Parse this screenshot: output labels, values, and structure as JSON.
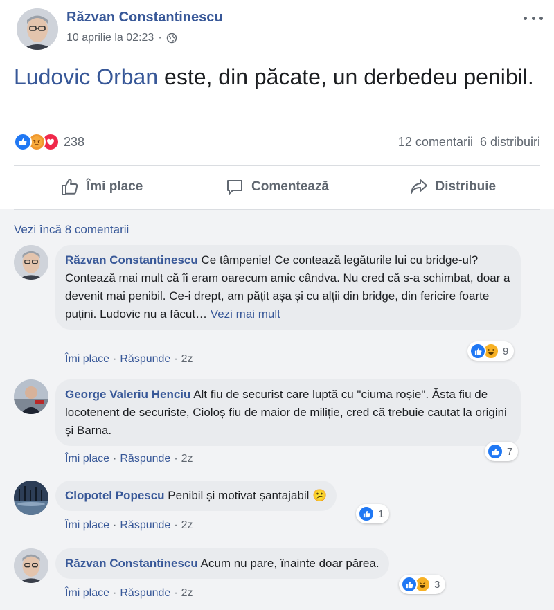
{
  "post": {
    "author": "Răzvan Constantinescu",
    "date": "10 aprilie la 02:23",
    "dot": "·",
    "privacy_icon": "globe-icon",
    "text_mention": "Ludovic Orban",
    "text_rest": " este, din păcate, un derbedeu penibil.",
    "reaction_icons": [
      "like-icon",
      "angry-icon",
      "love-icon"
    ],
    "reaction_count": "238",
    "comments_count": "12 comentarii",
    "shares_count": "6 distribuiri"
  },
  "actions": {
    "like": "Îmi place",
    "comment": "Comentează",
    "share": "Distribuie"
  },
  "comments_section": {
    "view_more": "Vezi încă 8 comentarii",
    "action_like": "Îmi place",
    "action_reply": "Răspunde",
    "dot": "·",
    "comments": [
      {
        "author": "Răzvan Constantinescu",
        "text": " Ce tâmpenie! Ce contează legăturile lui cu bridge-ul? Contează mai mult că îi eram oarecum amic cândva. Nu cred că s-a schimbat, doar a devenit mai penibil. Ce-i drept, am pățit așa și cu alții din bridge, din fericire foarte puțini. Ludovic nu a făcut… ",
        "see_more": "Vezi mai mult",
        "time": "2z",
        "reactions": [
          "like-icon",
          "haha-icon"
        ],
        "reaction_count": "9"
      },
      {
        "author": "George Valeriu Henciu",
        "text": " Alt fiu de securist care luptă cu \"ciuma roșie\". Ăsta fiu de locotenent de securiste, Cioloș fiu de maior de miliție, cred că trebuie cautat la origini și Barna.",
        "time": "2z",
        "reactions": [
          "like-icon"
        ],
        "reaction_count": "7"
      },
      {
        "author": "Clopotel Popescu",
        "text": " Penibil și motivat șantajabil",
        "emoji": "😕",
        "time": "2z",
        "reactions": [
          "like-icon"
        ],
        "reaction_count": "1"
      },
      {
        "author": "Răzvan Constantinescu",
        "text": " Acum nu pare, înainte doar părea.",
        "time": "2z",
        "reactions": [
          "like-icon",
          "haha-icon"
        ],
        "reaction_count": "3"
      }
    ]
  },
  "colors": {
    "link": "#385898",
    "like": "#2078f4",
    "angry": "#f0982e",
    "love": "#f0284a",
    "bubble": "#e9ebee",
    "comments_bg": "#f2f3f5"
  }
}
